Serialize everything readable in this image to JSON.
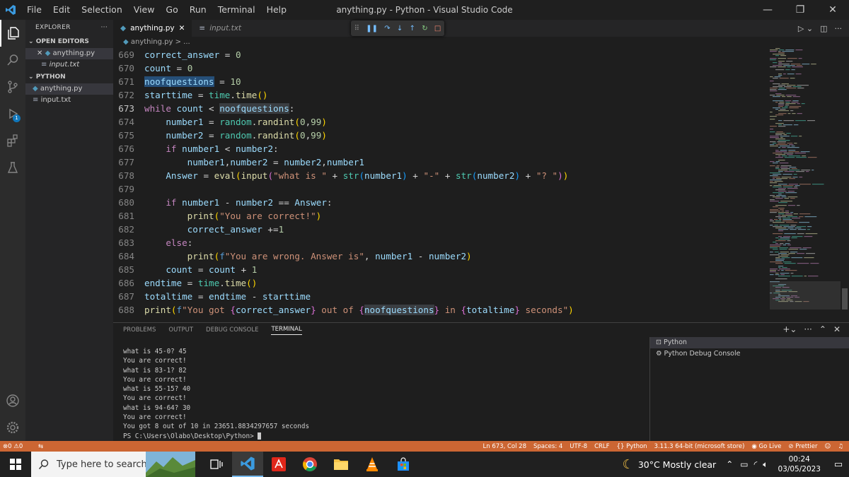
{
  "window": {
    "title": "anything.py - Python - Visual Studio Code",
    "menu": [
      "File",
      "Edit",
      "Selection",
      "View",
      "Go",
      "Run",
      "Terminal",
      "Help"
    ]
  },
  "sidebar": {
    "title": "EXPLORER",
    "open_editors_label": "OPEN EDITORS",
    "open_editors": [
      {
        "name": "anything.py",
        "type": "python"
      },
      {
        "name": "input.txt",
        "type": "text"
      }
    ],
    "folder_label": "PYTHON",
    "files": [
      {
        "name": "anything.py",
        "type": "python"
      },
      {
        "name": "input.txt",
        "type": "text"
      }
    ]
  },
  "activity": {
    "debug_badge": "1"
  },
  "tabs": [
    {
      "label": "anything.py",
      "active": true
    },
    {
      "label": "input.txt",
      "active": false
    }
  ],
  "breadcrumb": "anything.py > ...",
  "editor": {
    "line_numbers": [
      "669",
      "670",
      "671",
      "672",
      "673",
      "674",
      "675",
      "676",
      "677",
      "678",
      "679",
      "680",
      "681",
      "682",
      "683",
      "684",
      "685",
      "686",
      "687",
      "688"
    ],
    "current_line": "673",
    "lines": [
      "correct_answer = 0",
      "count = 0",
      "noofquestions = 10",
      "starttime = time.time()",
      "while count < noofquestions:",
      "    number1 = random.randint(0,99)",
      "    number2 = random.randint(0,99)",
      "    if number1 < number2:",
      "        number1,number2 = number2,number1",
      "    Answer = eval(input(\"what is \" + str(number1) + \"-\" + str(number2) + \"? \"))",
      "",
      "    if number1 - number2 == Answer:",
      "        print(\"You are correct!\")",
      "        correct_answer +=1",
      "    else:",
      "        print(f\"You are wrong. Answer is\", number1 - number2)",
      "    count = count + 1",
      "endtime = time.time()",
      "totaltime = endtime - starttime",
      "print(f\"You got {correct_answer} out of {noofquestions} in {totaltime} seconds\")"
    ]
  },
  "panel": {
    "tabs": [
      "PROBLEMS",
      "OUTPUT",
      "DEBUG CONSOLE",
      "TERMINAL"
    ],
    "active_tab": "TERMINAL",
    "terminal_lines": [
      "what is 45-0? 45",
      "You are correct!",
      "what is 83-1? 82",
      "You are correct!",
      "what is 55-15? 40",
      "You are correct!",
      "what is 94-64? 30",
      "You are correct!",
      "You got 8 out of 10 in 23651.8834297657 seconds"
    ],
    "prompt": "PS C:\\Users\\Olabo\\Desktop\\Python> ",
    "terminal_list": [
      "Python",
      "Python Debug Console"
    ]
  },
  "statusbar": {
    "errors": "0",
    "warnings": "0",
    "position": "Ln 673, Col 28",
    "spaces": "Spaces: 4",
    "encoding": "UTF-8",
    "eol": "CRLF",
    "language": "Python",
    "interpreter": "3.11.3 64-bit (microsoft store)",
    "golive": "Go Live",
    "prettier": "Prettier"
  },
  "taskbar": {
    "search_placeholder": "Type here to search",
    "weather": "30°C  Mostly clear",
    "time": "00:24",
    "date": "03/05/2023"
  },
  "colors": {
    "statusbar": "#cc6633",
    "activity": "#2c2c2c",
    "editor_bg": "#1e1e1e"
  }
}
